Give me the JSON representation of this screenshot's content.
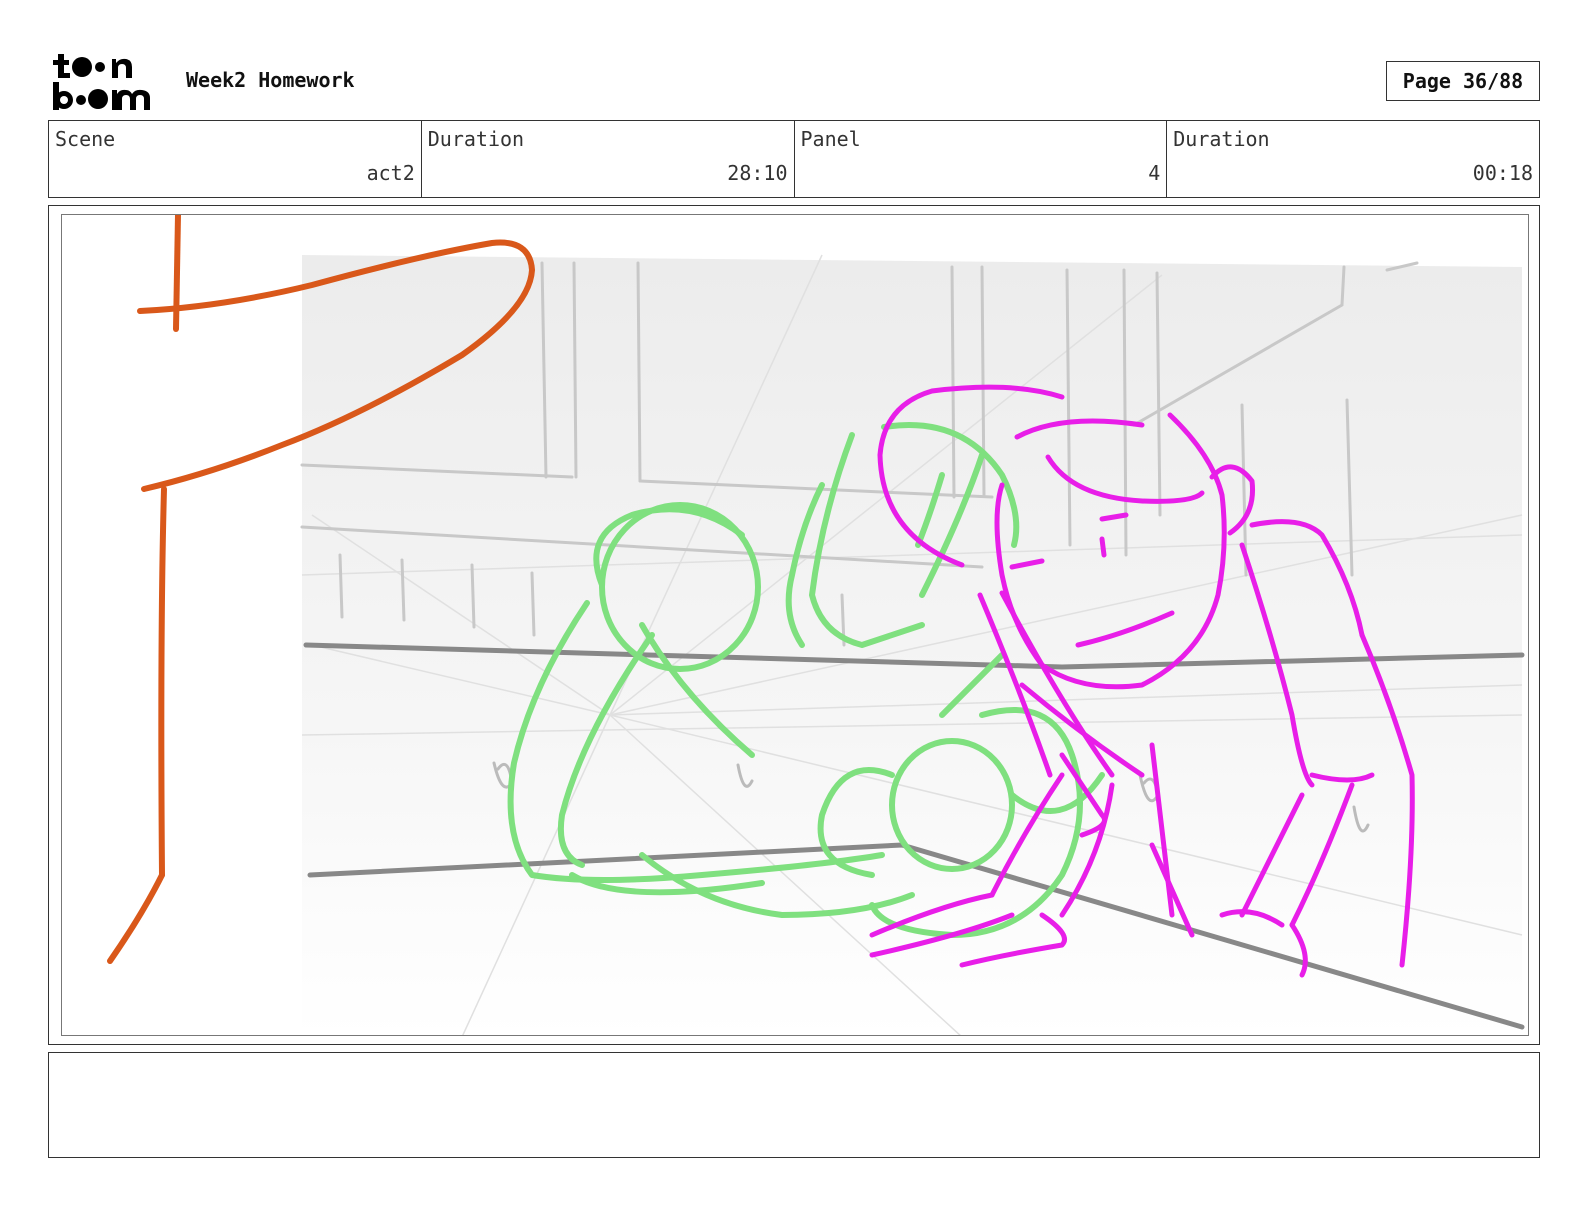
{
  "header": {
    "logo_text": "toon boom",
    "title": "Week2 Homework",
    "page_label": "Page 36/88"
  },
  "info": [
    {
      "label": "Scene",
      "value": "act2"
    },
    {
      "label": "Duration",
      "value": "28:10"
    },
    {
      "label": "Panel",
      "value": "4"
    },
    {
      "label": "Duration",
      "value": "00:18"
    }
  ],
  "panel": {
    "description": "",
    "colors": {
      "orange_sketch": "#d9581a",
      "green_sketch": "#7fe07f",
      "magenta_sketch": "#e81ee8",
      "background_lines": "#b8b8b8"
    }
  },
  "notes": {
    "text": ""
  }
}
